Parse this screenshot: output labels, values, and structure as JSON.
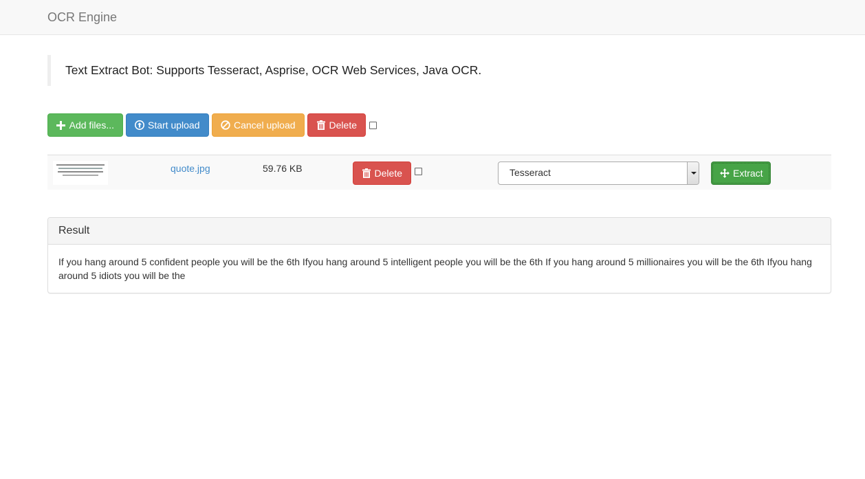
{
  "navbar": {
    "brand": "OCR Engine"
  },
  "intro": {
    "text": "Text Extract Bot: Supports Tesseract, Asprise, OCR Web Services, Java OCR."
  },
  "toolbar": {
    "add_files_label": "Add files...",
    "start_upload_label": "Start upload",
    "cancel_upload_label": "Cancel upload",
    "delete_label": "Delete",
    "select_all_checked": false
  },
  "files": [
    {
      "name": "quote.jpg",
      "size": "59.76 KB",
      "delete_label": "Delete",
      "engine_selected": "Tesseract",
      "extract_label": "Extract"
    }
  ],
  "result": {
    "heading": "Result",
    "text": "If you hang around 5 confident people you will be the 6th Ifyou hang around 5 intelligent people you will be the 6th If you hang around 5 millionaires you will be the 6th Ifyou hang around 5 idiots you will be the"
  },
  "colors": {
    "success": "#5cb85c",
    "primary": "#428bca",
    "warning": "#f0ad4e",
    "danger": "#d9534f",
    "link": "#428bca"
  },
  "icons": {
    "add": "plus-icon",
    "upload": "circle-arrow-up-icon",
    "cancel": "ban-icon",
    "delete": "trash-icon",
    "extract": "move-arrows-icon"
  }
}
